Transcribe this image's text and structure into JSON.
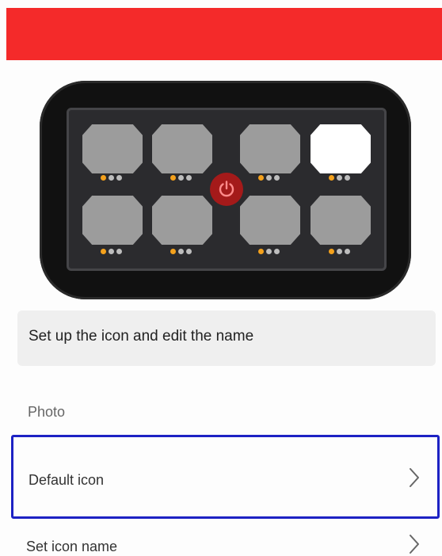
{
  "header": {
    "color": "#f42a2a"
  },
  "device": {
    "keys_top": [
      {
        "state": "grey",
        "indicator": "orange-dot-first"
      },
      {
        "state": "grey",
        "indicator": "orange-dot-first"
      },
      {
        "state": "grey",
        "indicator": "orange-dot-first"
      },
      {
        "state": "white-selected",
        "indicator": "orange-dot-first"
      }
    ],
    "keys_bottom": [
      {
        "state": "grey",
        "indicator": "orange-dot-first"
      },
      {
        "state": "grey",
        "indicator": "orange-dot-first"
      },
      {
        "state": "grey",
        "indicator": "orange-dot-first"
      },
      {
        "state": "grey",
        "indicator": "orange-dot-first"
      }
    ],
    "power_icon": "power-icon",
    "colors": {
      "key": "#9c9c9c",
      "key_selected": "#ffffff",
      "indicator_on": "#f4a11c",
      "indicator_off": "#bdbdbd",
      "power": "#a41a1a"
    }
  },
  "info": {
    "text": "Set up the icon and edit the name"
  },
  "section": {
    "label": "Photo"
  },
  "rows": [
    {
      "label": "Default icon",
      "icon": "chevron-right-icon",
      "selected": true
    },
    {
      "label": "Set icon name",
      "icon": "chevron-right-icon",
      "selected": false
    }
  ],
  "highlight_color": "#1d22c4"
}
